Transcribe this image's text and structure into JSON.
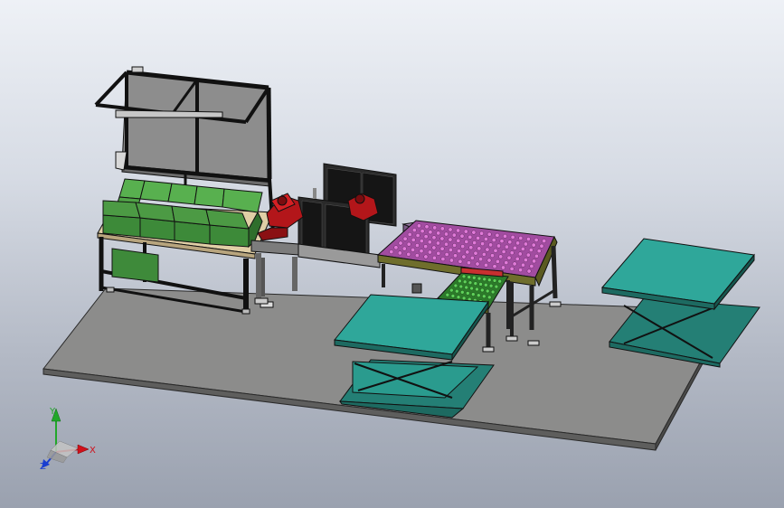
{
  "viewport": {
    "background_top": "#eef1f6",
    "background_bottom": "#9aa1af"
  },
  "model": {
    "base_plate_color": "#8a8b8a",
    "frame_color": "#1a1a1a",
    "box_color": "#3e8a3a",
    "robot_color": "#b3161a",
    "lift_table_color": "#2a9b8e",
    "conveyor_color": "#8a2a8a",
    "carton_color": "#7a5a86",
    "table_top_color": "#e3d3ac",
    "fence_panel_color": "#1f1f1f"
  },
  "triad": {
    "x_label": "X",
    "y_label": "Y",
    "z_label": "Z",
    "x_color": "#d0101a",
    "y_color": "#22a72a",
    "z_color": "#1a3ed0"
  }
}
